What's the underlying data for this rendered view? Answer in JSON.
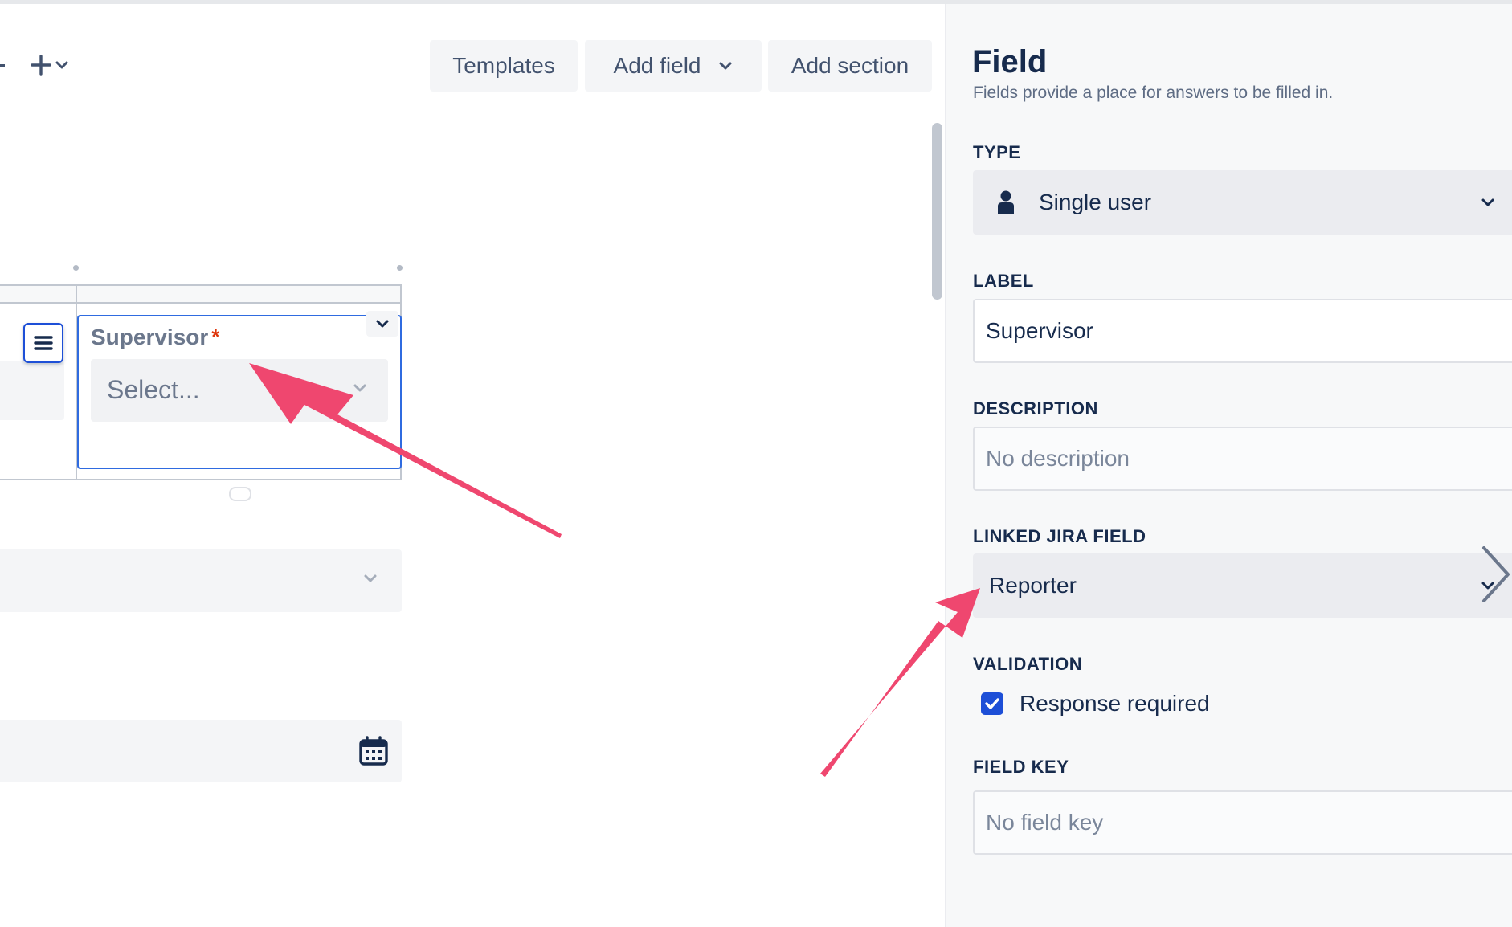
{
  "toolbar": {
    "templates_label": "Templates",
    "add_field_label": "Add field",
    "add_section_label": "Add section"
  },
  "form": {
    "supervisor_label": "Supervisor",
    "required_marker": "*",
    "supervisor_placeholder": "Select..."
  },
  "panel": {
    "title": "Field",
    "description": "Fields provide a place for answers to be filled in.",
    "type_label": "TYPE",
    "type_value": "Single user",
    "label_label": "LABEL",
    "label_value": "Supervisor",
    "description_label": "DESCRIPTION",
    "description_placeholder": "No description",
    "linked_label": "LINKED JIRA FIELD",
    "linked_value": "Reporter",
    "validation_label": "VALIDATION",
    "response_required_label": "Response required",
    "response_required_checked": true,
    "field_key_label": "FIELD KEY",
    "field_key_placeholder": "No field key"
  },
  "icons": {
    "plus": "plus-icon",
    "chevron": "chevron-down-icon",
    "menu": "hamburger-icon",
    "user": "user-icon",
    "calendar": "calendar-icon",
    "check": "check-icon",
    "side": "chevron-right-icon"
  },
  "colors": {
    "accent_blue": "#1d4fd7",
    "selection_border": "#2f6be0",
    "required_red": "#de350b",
    "annotation_arrow": "#ef476f",
    "panel_bg": "#f7f8f9"
  }
}
